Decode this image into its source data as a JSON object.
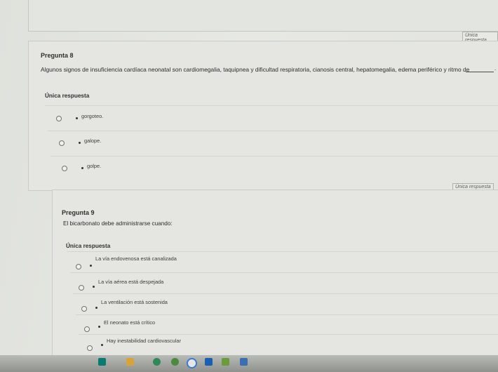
{
  "q8": {
    "badge": "Única respuesta",
    "title": "Pregunta 8",
    "text": "Algunos signos de insuficiencia cardíaca neonatal son cardiomegalia, taquipnea y dificultad respiratoria, cianosis central, hepatomegalia, edema periférico y ritmo de",
    "text_end": ".",
    "section": "Única respuesta",
    "options": [
      "gorgoteo.",
      "galope.",
      "golpe."
    ]
  },
  "q9": {
    "badge": "Única respuesta",
    "title": "Pregunta 9",
    "text": "El bicarbonato debe administrarse cuando:",
    "section": "Única respuesta",
    "options": [
      "La vía endovenosa está canalizada",
      "La vía aérea está despejada",
      "La ventilación está sostenida",
      "El neonato está crítico",
      "Hay inestabilidad cardiovascular"
    ]
  },
  "taskbar": {
    "icons": [
      "app-icon",
      "folder-icon",
      "chrome-icon",
      "security-icon",
      "edge-icon",
      "wifi-icon",
      "photos-icon"
    ],
    "colors": [
      "#0b7a73",
      "#d7a43a",
      "#2e8b57",
      "#1a5fb4",
      "#3aa0a8",
      "#6a9c3a",
      "#3a6fb4"
    ]
  }
}
